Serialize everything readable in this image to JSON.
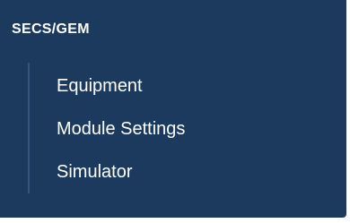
{
  "sidebar": {
    "section_title": "SECS/GEM",
    "items": [
      {
        "label": "Equipment"
      },
      {
        "label": "Module Settings"
      },
      {
        "label": "Simulator"
      }
    ]
  },
  "colors": {
    "panel_background": "#1b3a5e",
    "text": "#ffffff",
    "guide_line": "#33557d"
  }
}
